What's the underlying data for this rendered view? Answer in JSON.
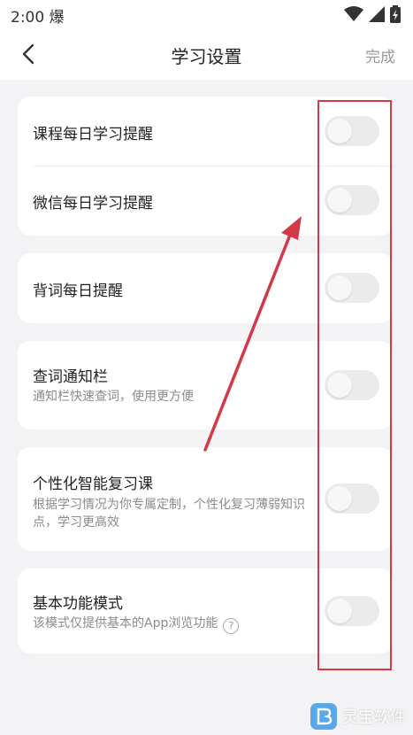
{
  "status_bar": {
    "time": "2:00 爆"
  },
  "header": {
    "title": "学习设置",
    "done_label": "完成"
  },
  "settings": [
    {
      "title": "课程每日学习提醒",
      "subtitle": "",
      "enabled": false
    },
    {
      "title": "微信每日学习提醒",
      "subtitle": "",
      "enabled": false
    },
    {
      "title": "背词每日提醒",
      "subtitle": "",
      "enabled": false
    },
    {
      "title": "查词通知栏",
      "subtitle": "通知栏快速查词，使用更方便",
      "enabled": false
    },
    {
      "title": "个性化智能复习课",
      "subtitle": "根据学习情况为你专属定制，个性化复习薄弱知识点，学习更高效",
      "enabled": false
    },
    {
      "title": "基本功能模式",
      "subtitle": "该模式仅提供基本的App浏览功能",
      "enabled": false
    }
  ],
  "watermark": {
    "text": "灵宝软件"
  },
  "colors": {
    "background": "#f3f3f5",
    "card": "#ffffff",
    "toggle_off": "#ebebeb",
    "annotation": "#d33a46"
  }
}
